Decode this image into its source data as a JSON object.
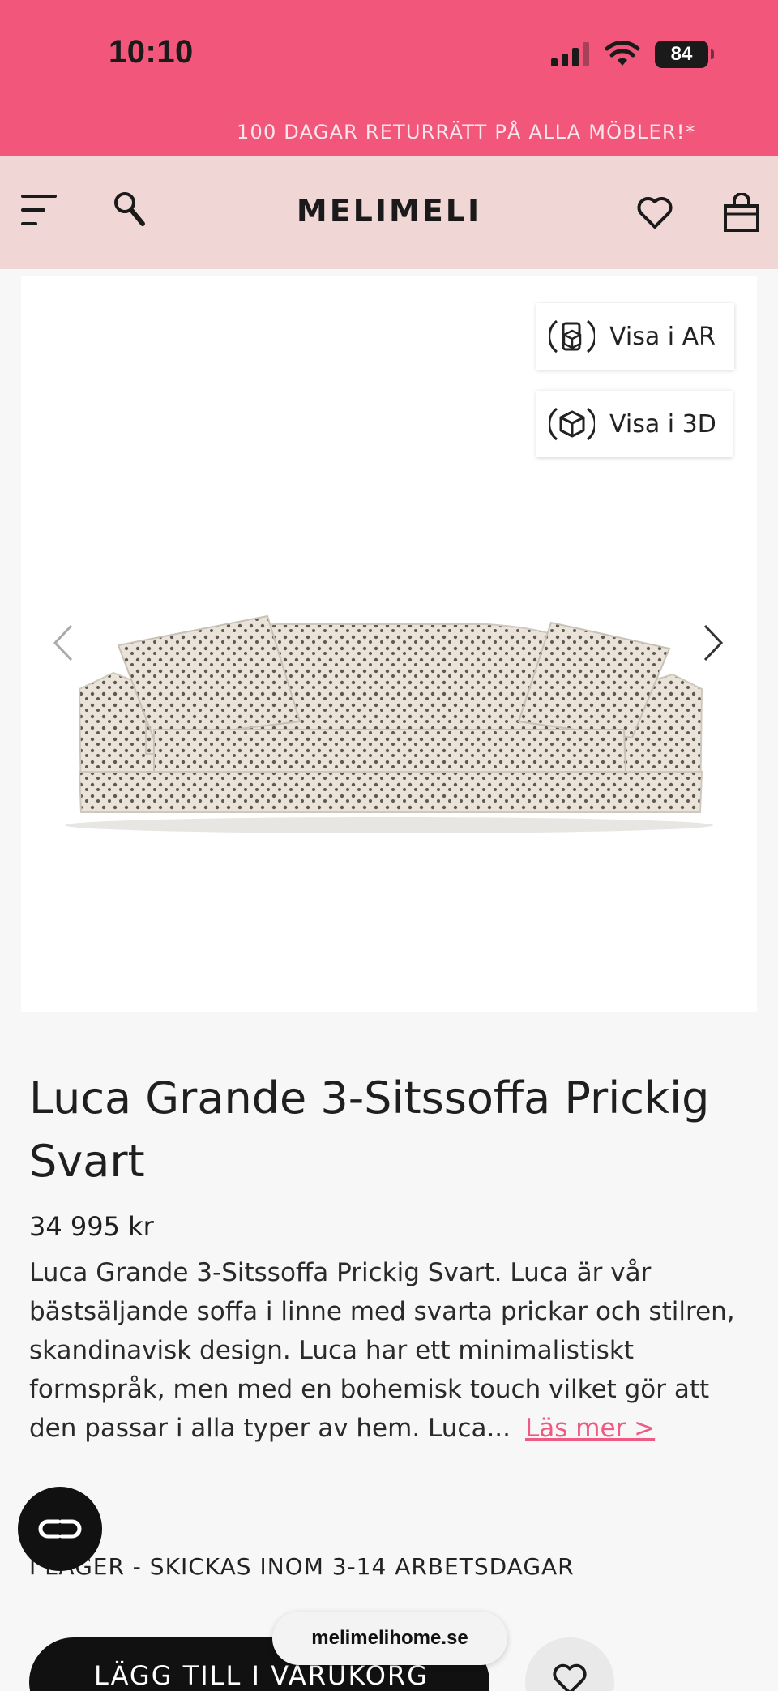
{
  "status_bar": {
    "time": "10:10",
    "battery": "84"
  },
  "promo": {
    "text": "100 DAGAR RETURRÄTT PÅ ALLA MÖBLER!*"
  },
  "header": {
    "logo": "MELIMELI"
  },
  "gallery": {
    "ar_label": "Visa i AR",
    "three_d_label": "Visa i 3D"
  },
  "product": {
    "title": "Luca Grande 3-Sitssoffa Prickig Svart",
    "price": "34 995 kr",
    "description": "Luca Grande 3-Sitssoffa Prickig Svart. Luca är vår bästsäljande soffa i linne med svarta prickar och stilren, skandinavisk design. Luca har ett minimalistiskt formspråk, men med en bohemisk touch vilket gör att den passar i alla typer av hem. Luca...",
    "read_more": "Läs mer >",
    "stock": "I LAGER - SKICKAS INOM 3-14 ARBETSDAGAR"
  },
  "actions": {
    "add_to_cart": "LÄGG TILL I VARUKORG"
  },
  "browser": {
    "url": "melimelihome.se"
  },
  "colors": {
    "brand_pink": "#f2577b",
    "header_bg": "#f1d6d6",
    "link_pink": "#ee5a83"
  }
}
